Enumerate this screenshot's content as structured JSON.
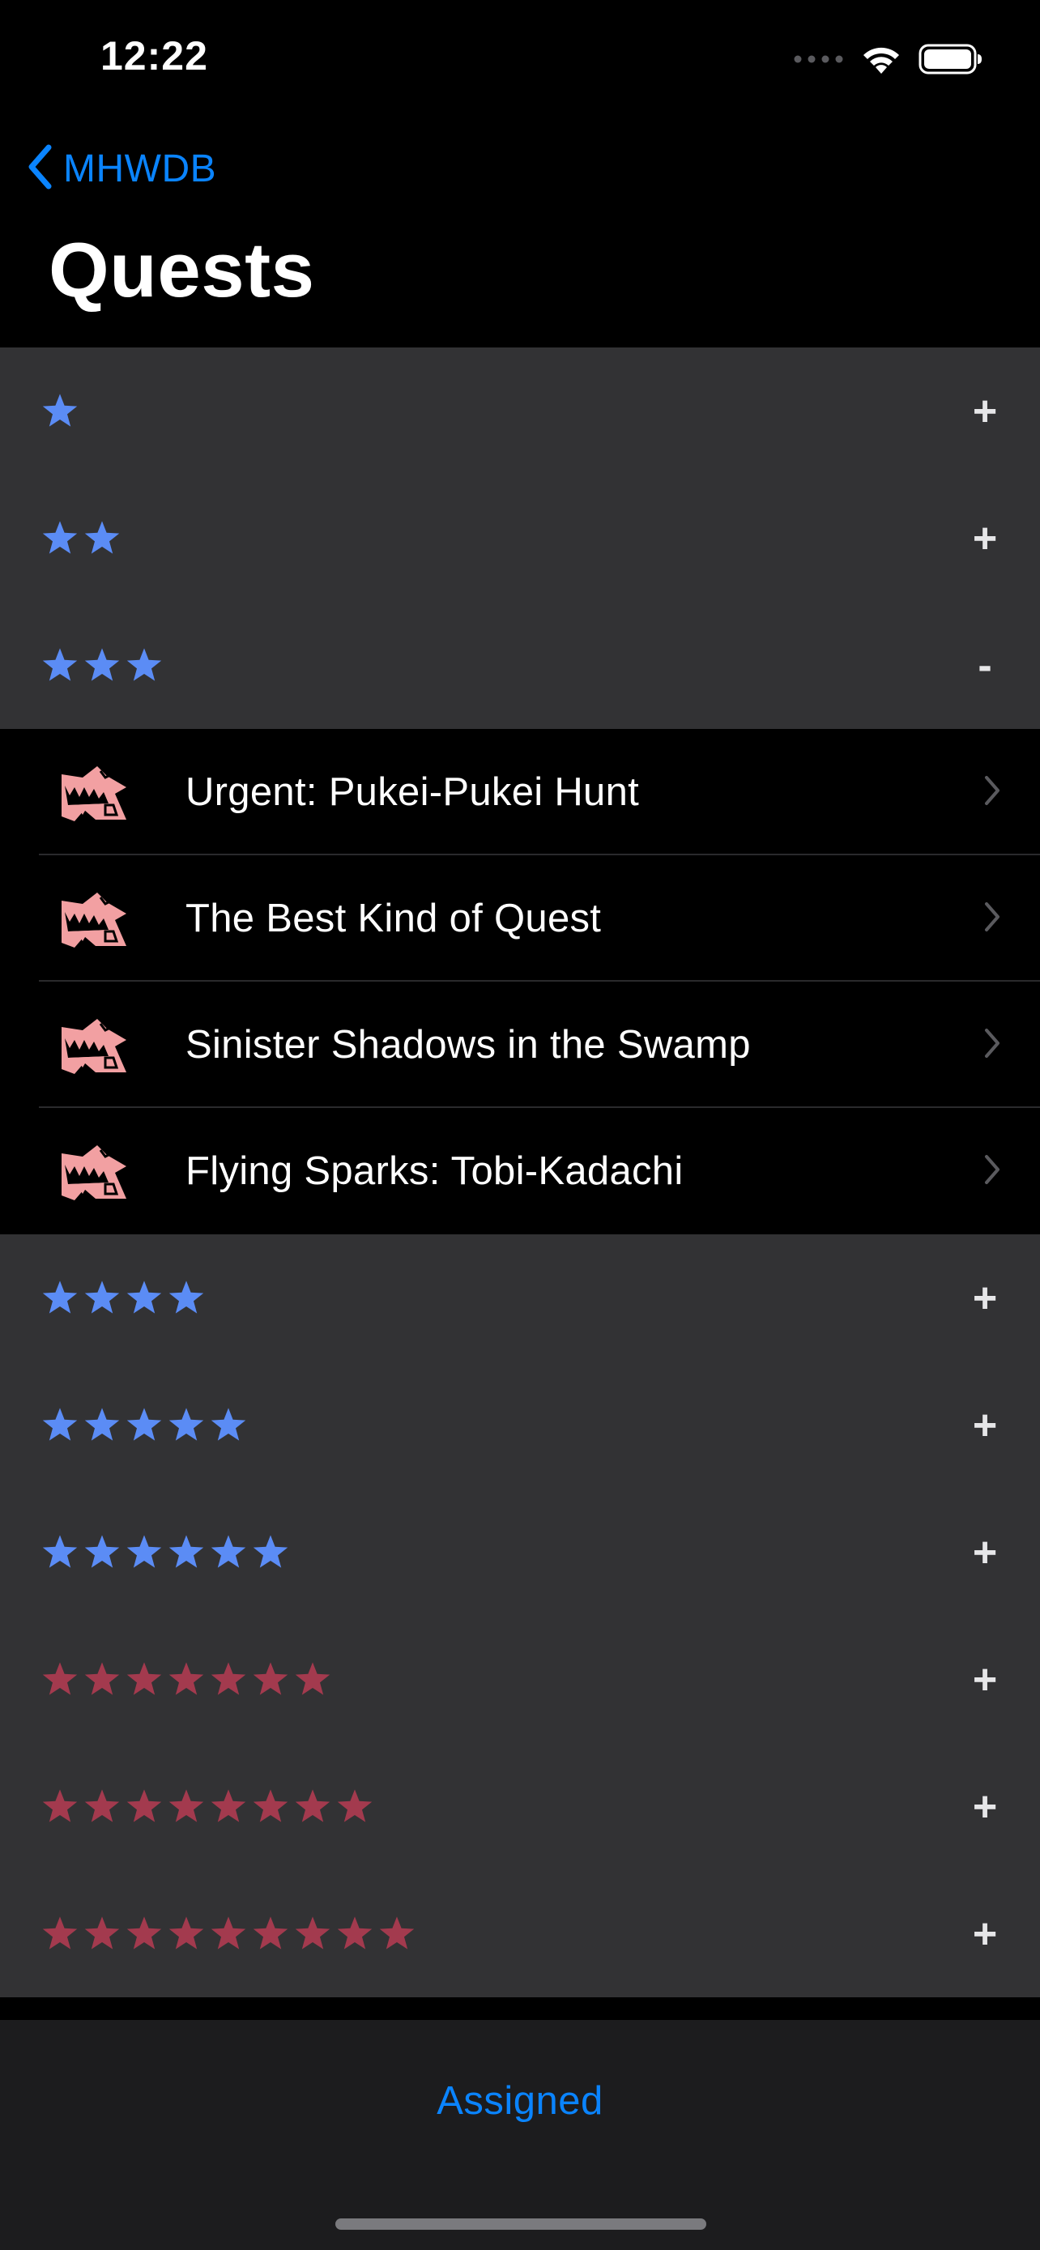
{
  "status_bar": {
    "time": "12:22",
    "icons": [
      "cellular-dots-icon",
      "wifi-icon",
      "battery-icon"
    ]
  },
  "nav": {
    "back_label": "MHWDB",
    "title": "Quests"
  },
  "colors": {
    "accent": "#0a84ff",
    "star_low_rank": "#5b8cf5",
    "star_high_rank": "#a33a4e",
    "section_background": "#323234",
    "row_background": "#000000",
    "quest_icon": "#f2a0a2"
  },
  "sections": [
    {
      "stars": 1,
      "star_color": "blue",
      "toggle": "+",
      "expanded": false,
      "quests": []
    },
    {
      "stars": 2,
      "star_color": "blue",
      "toggle": "+",
      "expanded": false,
      "quests": []
    },
    {
      "stars": 3,
      "star_color": "blue",
      "toggle": "-",
      "expanded": true,
      "quests": [
        {
          "label": "Urgent: Pukei-Pukei Hunt",
          "icon": "monster-quest-icon"
        },
        {
          "label": "The Best Kind of Quest",
          "icon": "monster-quest-icon"
        },
        {
          "label": "Sinister Shadows in the Swamp",
          "icon": "monster-quest-icon"
        },
        {
          "label": "Flying Sparks: Tobi-Kadachi",
          "icon": "monster-quest-icon"
        }
      ]
    },
    {
      "stars": 4,
      "star_color": "blue",
      "toggle": "+",
      "expanded": false,
      "quests": []
    },
    {
      "stars": 5,
      "star_color": "blue",
      "toggle": "+",
      "expanded": false,
      "quests": []
    },
    {
      "stars": 6,
      "star_color": "blue",
      "toggle": "+",
      "expanded": false,
      "quests": []
    },
    {
      "stars": 7,
      "star_color": "red",
      "toggle": "+",
      "expanded": false,
      "quests": []
    },
    {
      "stars": 8,
      "star_color": "red",
      "toggle": "+",
      "expanded": false,
      "quests": []
    },
    {
      "stars": 9,
      "star_color": "red",
      "toggle": "+",
      "expanded": false,
      "quests": []
    }
  ],
  "bottom_bar": {
    "tab_label": "Assigned"
  }
}
